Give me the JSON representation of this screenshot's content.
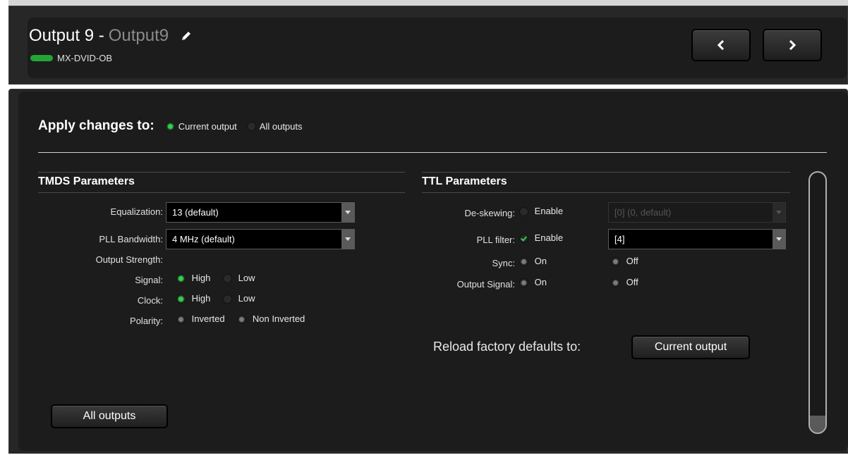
{
  "header": {
    "title": "Output 9 -",
    "name": "Output9",
    "device": "MX-DVID-OB",
    "status_color": "#22a535",
    "edit_icon": "pencil-icon",
    "prev_icon": "chevron-left-icon",
    "next_icon": "chevron-right-icon"
  },
  "apply": {
    "label": "Apply changes to:",
    "options": [
      "Current output",
      "All outputs"
    ],
    "selected": "Current output"
  },
  "tmds": {
    "title": "TMDS Parameters",
    "equalization_label": "Equalization:",
    "equalization_value": "13 (default)",
    "pll_bandwidth_label": "PLL Bandwidth:",
    "pll_bandwidth_value": "4 MHz (default)",
    "output_strength_label": "Output Strength:",
    "signal_label": "Signal:",
    "signal_high": "High",
    "signal_low": "Low",
    "signal_selected": "High",
    "clock_label": "Clock:",
    "clock_high": "High",
    "clock_low": "Low",
    "clock_selected": "High",
    "polarity_label": "Polarity:",
    "polarity_inverted": "Inverted",
    "polarity_non_inverted": "Non Inverted"
  },
  "ttl": {
    "title": "TTL Parameters",
    "deskewing_label": "De-skewing:",
    "deskewing_enable": "Enable",
    "deskewing_value": "[0] (0, default)",
    "pll_filter_label": "PLL filter:",
    "pll_filter_enable": "Enable",
    "pll_filter_value": "[4]",
    "sync_label": "Sync:",
    "sync_on": "On",
    "sync_off": "Off",
    "output_signal_label": "Output Signal:",
    "output_signal_on": "On",
    "output_signal_off": "Off"
  },
  "reload": {
    "label": "Reload factory defaults to:",
    "current_output_button": "Current output",
    "all_outputs_button": "All outputs"
  },
  "colors": {
    "accent_green": "#2fd24a",
    "background": "#1c1c1c"
  }
}
